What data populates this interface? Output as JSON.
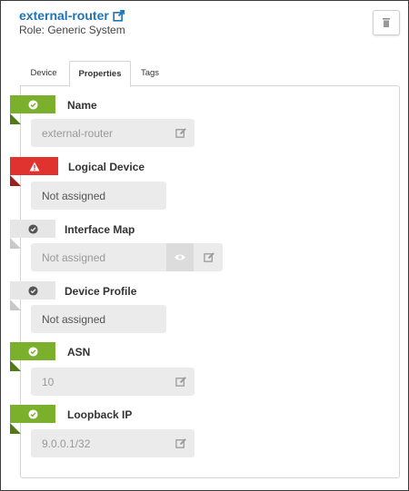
{
  "header": {
    "title": "external-router",
    "role": "Role: Generic System"
  },
  "tabs": [
    {
      "label": "Device",
      "active": false
    },
    {
      "label": "Properties",
      "active": true
    },
    {
      "label": "Tags",
      "active": false
    }
  ],
  "fields": {
    "name": {
      "label": "Name",
      "status": "ok",
      "value": "external-router"
    },
    "logical_device": {
      "label": "Logical Device",
      "status": "error",
      "value": "Not assigned"
    },
    "interface_map": {
      "label": "Interface Map",
      "status": "neutral",
      "value": "Not assigned"
    },
    "device_profile": {
      "label": "Device Profile",
      "status": "neutral",
      "value": "Not assigned"
    },
    "asn": {
      "label": "ASN",
      "status": "ok",
      "value": "10"
    },
    "loopback_ip": {
      "label": "Loopback IP",
      "status": "ok",
      "value": "9.0.0.1/32"
    }
  },
  "colors": {
    "title": "#1f74b5",
    "ok": "#7ab02c",
    "error": "#e0332f",
    "neutral": "#e6e6e6"
  }
}
